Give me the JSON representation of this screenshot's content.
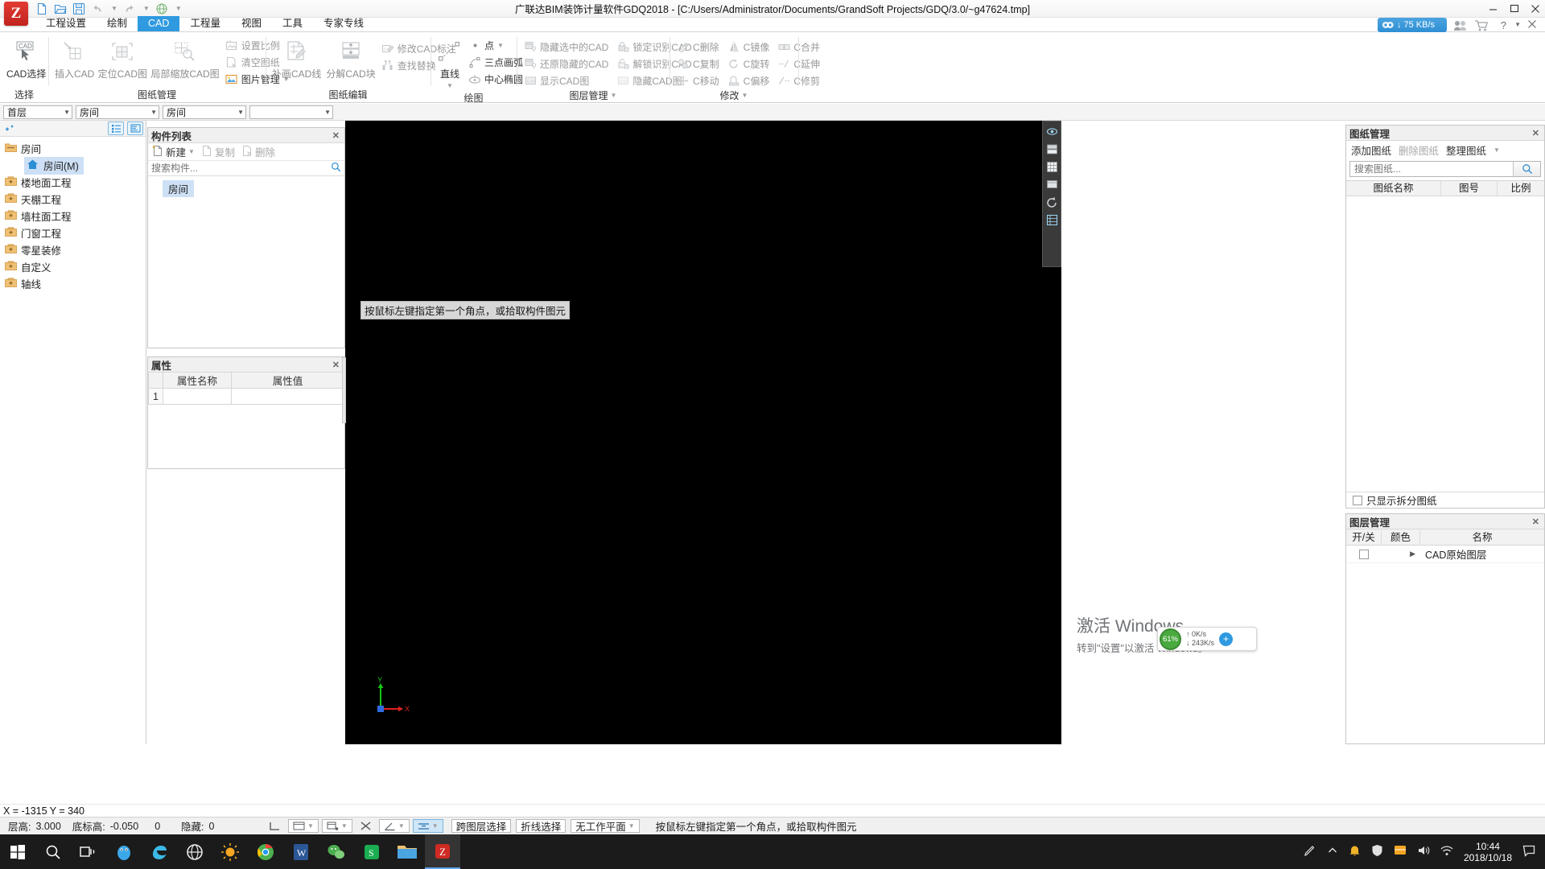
{
  "window": {
    "title": "广联达BIM装饰计量软件GDQ2018 - [C:/Users/Administrator/Documents/GrandSoft Projects/GDQ/3.0/~g47624.tmp]",
    "logo_letter": "Z",
    "minimize": "—",
    "maximize": "▢",
    "close": "✕"
  },
  "quick_access": [
    {
      "name": "new-file-icon",
      "label": "新建"
    },
    {
      "name": "open-file-icon",
      "label": "打开"
    },
    {
      "name": "save-icon",
      "label": "保存"
    },
    {
      "name": "undo-icon",
      "label": "撤销"
    },
    {
      "name": "redo-icon",
      "label": "恢复"
    },
    {
      "name": "globe-icon",
      "label": "云"
    },
    {
      "name": "customize-qat-icon",
      "label": "自定义快速访问工具栏"
    }
  ],
  "tabs": [
    {
      "label": "工程设置",
      "active": false
    },
    {
      "label": "绘制",
      "active": false
    },
    {
      "label": "CAD",
      "active": true
    },
    {
      "label": "工程量",
      "active": false
    },
    {
      "label": "视图",
      "active": false
    },
    {
      "label": "工具",
      "active": false
    },
    {
      "label": "专家专线",
      "active": false
    }
  ],
  "ribbon": {
    "groups": [
      {
        "name": "选择",
        "big": [
          {
            "label": "CAD选择",
            "icon": "cad-cursor-icon",
            "enabled": true
          }
        ],
        "smalls": []
      },
      {
        "name": "图纸管理",
        "big": [
          {
            "label": "插入CAD",
            "icon": "insert-cad-icon",
            "enabled": false
          },
          {
            "label": "定位CAD图",
            "icon": "locate-cad-icon",
            "enabled": false
          },
          {
            "label": "局部缩放CAD图",
            "icon": "zoom-cad-icon",
            "enabled": false
          }
        ],
        "smalls": [
          {
            "label": "设置比例",
            "icon": "set-scale-icon",
            "enabled": false
          },
          {
            "label": "清空图纸",
            "icon": "clear-drawing-icon",
            "enabled": false
          },
          {
            "label": "图片管理",
            "icon": "image-manage-icon",
            "enabled": true,
            "dropdown": true
          }
        ]
      },
      {
        "name": "图纸编辑",
        "big": [
          {
            "label": "补画CAD线",
            "icon": "draw-cad-line-icon",
            "enabled": false
          },
          {
            "label": "分解CAD块",
            "icon": "explode-cad-block-icon",
            "enabled": false
          }
        ],
        "smalls": [
          {
            "label": "修改CAD标注",
            "icon": "edit-cad-dim-icon",
            "enabled": false
          },
          {
            "label": "查找替换",
            "icon": "find-replace-icon",
            "enabled": false
          }
        ]
      },
      {
        "name": "绘图",
        "big": [
          {
            "label": "直线",
            "icon": "line-icon",
            "enabled": true,
            "dropdown": true
          }
        ],
        "smalls": [
          {
            "label": "点",
            "icon": "point-icon",
            "enabled": true,
            "dropdown": true
          },
          {
            "label": "三点画弧",
            "icon": "three-point-arc-icon",
            "enabled": true,
            "dropdown": true
          },
          {
            "label": "中心椭圆",
            "icon": "center-ellipse-icon",
            "enabled": true,
            "dropdown": true
          }
        ]
      },
      {
        "name": "图层管理",
        "dropdown": true,
        "smalls_cols": [
          [
            {
              "label": "隐藏选中的CAD",
              "icon": "hide-selected-cad-icon",
              "enabled": false
            },
            {
              "label": "还原隐藏的CAD",
              "icon": "restore-hidden-cad-icon",
              "enabled": false
            },
            {
              "label": "显示CAD图",
              "icon": "show-cad-icon",
              "enabled": false
            }
          ],
          [
            {
              "label": "锁定识别CAD",
              "icon": "lock-recognize-cad-icon",
              "enabled": false
            },
            {
              "label": "解锁识别CAD",
              "icon": "unlock-recognize-cad-icon",
              "enabled": false
            },
            {
              "label": "隐藏CAD图",
              "icon": "hide-cad-icon",
              "enabled": false
            }
          ]
        ]
      },
      {
        "name": "修改",
        "dropdown": true,
        "smalls_cols": [
          [
            {
              "label": "C删除",
              "icon": "c-delete-icon",
              "enabled": false
            },
            {
              "label": "C复制",
              "icon": "c-copy-icon",
              "enabled": false
            },
            {
              "label": "C移动",
              "icon": "c-move-icon",
              "enabled": false
            }
          ],
          [
            {
              "label": "C镜像",
              "icon": "c-mirror-icon",
              "enabled": false
            },
            {
              "label": "C旋转",
              "icon": "c-rotate-icon",
              "enabled": false
            },
            {
              "label": "C偏移",
              "icon": "c-offset-icon",
              "enabled": false
            }
          ],
          [
            {
              "label": "C合并",
              "icon": "c-merge-icon",
              "enabled": false
            },
            {
              "label": "C延伸",
              "icon": "c-extend-icon",
              "enabled": false
            },
            {
              "label": "C修剪",
              "icon": "c-trim-icon",
              "enabled": false
            }
          ]
        ]
      }
    ]
  },
  "combos": [
    {
      "name": "floor-select",
      "value": "首层"
    },
    {
      "name": "category-select",
      "value": "房间"
    },
    {
      "name": "component-select",
      "value": "房间"
    },
    {
      "name": "extra-select",
      "value": ""
    }
  ],
  "tree": {
    "toolbar": {
      "add_icon": "add-node-icon",
      "list_view_icon": "list-view-icon",
      "detail_view_icon": "detail-view-icon"
    },
    "nodes": [
      {
        "label": "房间",
        "icon": "folder-open-icon",
        "level": 0,
        "selected": false
      },
      {
        "label": "房间(M)",
        "icon": "room-home-icon",
        "level": 1,
        "selected": true
      },
      {
        "label": "楼地面工程",
        "icon": "folder-plus-icon",
        "level": 0,
        "selected": false
      },
      {
        "label": "天棚工程",
        "icon": "folder-plus-icon",
        "level": 0,
        "selected": false
      },
      {
        "label": "墙柱面工程",
        "icon": "folder-plus-icon",
        "level": 0,
        "selected": false
      },
      {
        "label": "门窗工程",
        "icon": "folder-plus-icon",
        "level": 0,
        "selected": false
      },
      {
        "label": "零星装修",
        "icon": "folder-plus-icon",
        "level": 0,
        "selected": false
      },
      {
        "label": "自定义",
        "icon": "folder-plus-icon",
        "level": 0,
        "selected": false
      },
      {
        "label": "轴线",
        "icon": "folder-plus-icon",
        "level": 0,
        "selected": false
      }
    ]
  },
  "component_list": {
    "title": "构件列表",
    "close": "✕",
    "toolbar": [
      {
        "label": "新建",
        "icon": "new-component-icon",
        "enabled": true,
        "dropdown": true
      },
      {
        "label": "复制",
        "icon": "copy-icon",
        "enabled": false
      },
      {
        "label": "删除",
        "icon": "delete-icon",
        "enabled": false
      }
    ],
    "search_placeholder": "搜索构件...",
    "search_icon": "search-icon",
    "items": [
      {
        "label": "房间",
        "selected": true
      }
    ]
  },
  "properties": {
    "title": "属性",
    "close": "✕",
    "columns": [
      "",
      "属性名称",
      "属性值"
    ],
    "rows": [
      {
        "num": "1",
        "name": "",
        "value": ""
      }
    ]
  },
  "canvas": {
    "hint": "按鼠标左键指定第一个角点，或拾取构件图元",
    "axis": {
      "x_label": "X",
      "y_label": "Y"
    },
    "vtools": [
      {
        "name": "cad-eye-icon"
      },
      {
        "name": "cad-layers-icon"
      },
      {
        "name": "cad-grid-icon"
      },
      {
        "name": "cad-display-icon"
      },
      {
        "name": "cad-rotate-icon"
      },
      {
        "name": "cad-table-icon"
      }
    ]
  },
  "drawing_manager": {
    "title": "图纸管理",
    "close": "✕",
    "toolbar": [
      {
        "label": "添加图纸",
        "enabled": true
      },
      {
        "label": "删除图纸",
        "enabled": false
      },
      {
        "label": "整理图纸",
        "enabled": true,
        "dropdown": true
      }
    ],
    "search_placeholder": "搜索图纸...",
    "search_icon": "search-icon",
    "columns": [
      "图纸名称",
      "图号",
      "比例"
    ],
    "rows": [],
    "footer_checkbox_label": "只显示拆分图纸",
    "footer_checked": false
  },
  "layer_manager": {
    "title": "图层管理",
    "close": "✕",
    "columns": [
      "开/关",
      "颜色",
      "名称"
    ],
    "rows": [
      {
        "onoff": false,
        "color": "",
        "expand": "▶",
        "name": "CAD原始图层"
      }
    ]
  },
  "status_bar": {
    "coords": "X = -1315 Y = 340",
    "floor_height_label": "层高:",
    "floor_height_value": "3.000",
    "base_height_label": "底标高:",
    "base_height_value": "-0.050",
    "zero_value": "0",
    "hidden_label": "隐藏:",
    "hidden_value": "0",
    "toggles": [
      {
        "name": "ortho-toggle",
        "icon": "ortho-icon",
        "active": false
      },
      {
        "name": "layer-toggle",
        "icon": "layer-icon",
        "active": false,
        "dropdown": true
      },
      {
        "name": "snap-toggle",
        "icon": "snap-icon",
        "active": false,
        "dropdown": true
      },
      {
        "name": "nosnap-toggle",
        "icon": "nosnap-icon",
        "active": false
      },
      {
        "name": "angle-toggle",
        "icon": "angle-icon",
        "active": false,
        "dropdown": true
      },
      {
        "name": "align-toggle",
        "icon": "align-icon",
        "active": true,
        "dropdown": true
      }
    ],
    "buttons": [
      {
        "label": "跨图层选择",
        "active": false
      },
      {
        "label": "折线选择",
        "active": false
      },
      {
        "label": "无工作平面",
        "active": false,
        "dropdown": true
      }
    ],
    "message": "按鼠标左键指定第一个角点，或拾取构件图元"
  },
  "watermark": {
    "line1": "激活 Windows",
    "line2": "转到\"设置\"以激活 Windows。"
  },
  "net_widget": {
    "percent": "61%",
    "up_speed": "0K/s",
    "down_speed": "243K/s",
    "up_arrow": "↑",
    "down_arrow": "↓",
    "plus": "+"
  },
  "net_badge": {
    "speed": "75 KB/s",
    "down_arrow": "↓"
  },
  "taskbar": {
    "items": [
      {
        "name": "start-button",
        "icon": "windows-icon"
      },
      {
        "name": "search-button",
        "icon": "search-circle-icon"
      },
      {
        "name": "task-view-button",
        "icon": "task-view-icon"
      },
      {
        "name": "taskbar-app-qq",
        "icon": "penguin-icon"
      },
      {
        "name": "taskbar-app-edge",
        "icon": "edge-icon"
      },
      {
        "name": "taskbar-app-browser",
        "icon": "browser-icon"
      },
      {
        "name": "taskbar-app-sun",
        "icon": "sun-icon"
      },
      {
        "name": "taskbar-app-chrome",
        "icon": "chrome-icon"
      },
      {
        "name": "taskbar-app-word",
        "icon": "word-icon"
      },
      {
        "name": "taskbar-app-wechat",
        "icon": "wechat-icon"
      },
      {
        "name": "taskbar-app-s",
        "icon": "s-green-icon"
      },
      {
        "name": "taskbar-app-folder",
        "icon": "folder-icon"
      },
      {
        "name": "taskbar-app-gdq",
        "icon": "gdq-icon",
        "active": true
      }
    ],
    "tray": [
      {
        "name": "tray-pen-icon"
      },
      {
        "name": "tray-chevron-up-icon"
      },
      {
        "name": "tray-bell-icon"
      },
      {
        "name": "tray-shield-icon"
      },
      {
        "name": "tray-flag-icon"
      },
      {
        "name": "tray-volume-icon"
      },
      {
        "name": "tray-network-icon"
      }
    ],
    "clock_time": "10:44",
    "clock_date": "2018/10/18",
    "notification_icon": "action-center-icon"
  }
}
